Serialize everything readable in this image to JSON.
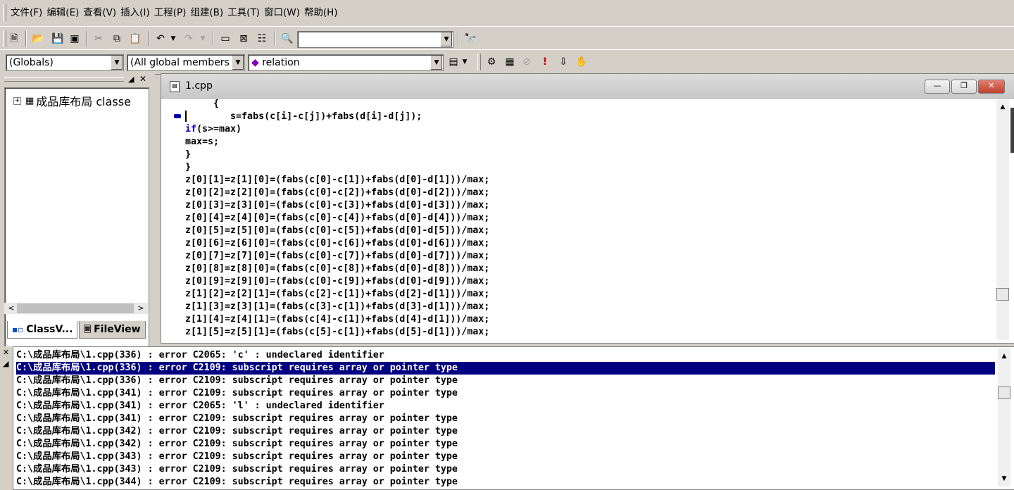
{
  "menu": [
    "文件(F)",
    "编辑(E)",
    "查看(V)",
    "插入(I)",
    "工程(P)",
    "组建(B)",
    "工具(T)",
    "窗口(W)",
    "帮助(H)"
  ],
  "toolbar2": {
    "find_combo_value": ""
  },
  "toolbar3": {
    "scope_combo": "(Globals)",
    "members_combo": "(All global members",
    "function_combo": "relation"
  },
  "classview": {
    "tree_root": "成品库布局 classe",
    "tabs": [
      "ClassV...",
      "FileView"
    ]
  },
  "editor": {
    "filename": "1.cpp",
    "lines": [
      "     {",
      "        s=fabs(c[i]-c[j])+fabs(d[i]-d[j]);",
      "if(s>=max)",
      "max=s;",
      "}",
      "}",
      "z[0][1]=z[1][0]=(fabs(c[0]-c[1])+fabs(d[0]-d[1]))/max;",
      "z[0][2]=z[2][0]=(fabs(c[0]-c[2])+fabs(d[0]-d[2]))/max;",
      "z[0][3]=z[3][0]=(fabs(c[0]-c[3])+fabs(d[0]-d[3]))/max;",
      "z[0][4]=z[4][0]=(fabs(c[0]-c[4])+fabs(d[0]-d[4]))/max;",
      "z[0][5]=z[5][0]=(fabs(c[0]-c[5])+fabs(d[0]-d[5]))/max;",
      "z[0][6]=z[6][0]=(fabs(c[0]-c[6])+fabs(d[0]-d[6]))/max;",
      "z[0][7]=z[7][0]=(fabs(c[0]-c[7])+fabs(d[0]-d[7]))/max;",
      "z[0][8]=z[8][0]=(fabs(c[0]-c[8])+fabs(d[0]-d[8]))/max;",
      "z[0][9]=z[9][0]=(fabs(c[0]-c[9])+fabs(d[0]-d[9]))/max;",
      "z[1][2]=z[2][1]=(fabs(c[2]-c[1])+fabs(d[2]-d[1]))/max;",
      "z[1][3]=z[3][1]=(fabs(c[3]-c[1])+fabs(d[3]-d[1]))/max;",
      "z[1][4]=z[4][1]=(fabs(c[4]-c[1])+fabs(d[4]-d[1]))/max;",
      "z[1][5]=z[5][1]=(fabs(c[5]-c[1])+fabs(d[5]-d[1]))/max;"
    ]
  },
  "output": {
    "lines": [
      "C:\\成品库布局\\1.cpp(336) : error C2065: 'c' : undeclared identifier",
      "C:\\成品库布局\\1.cpp(336) : error C2109: subscript requires array or pointer type",
      "C:\\成品库布局\\1.cpp(336) : error C2109: subscript requires array or pointer type",
      "C:\\成品库布局\\1.cpp(341) : error C2109: subscript requires array or pointer type",
      "C:\\成品库布局\\1.cpp(341) : error C2065: 'l' : undeclared identifier",
      "C:\\成品库布局\\1.cpp(341) : error C2109: subscript requires array or pointer type",
      "C:\\成品库布局\\1.cpp(342) : error C2109: subscript requires array or pointer type",
      "C:\\成品库布局\\1.cpp(342) : error C2109: subscript requires array or pointer type",
      "C:\\成品库布局\\1.cpp(343) : error C2109: subscript requires array or pointer type",
      "C:\\成品库布局\\1.cpp(343) : error C2109: subscript requires array or pointer type",
      "C:\\成品库布局\\1.cpp(344) : error C2109: subscript requires array or pointer type"
    ],
    "selected_index": 1
  },
  "colors": {
    "selection": "#000080",
    "keyword": "#0000cc",
    "chrome": "#d4d0c8"
  }
}
